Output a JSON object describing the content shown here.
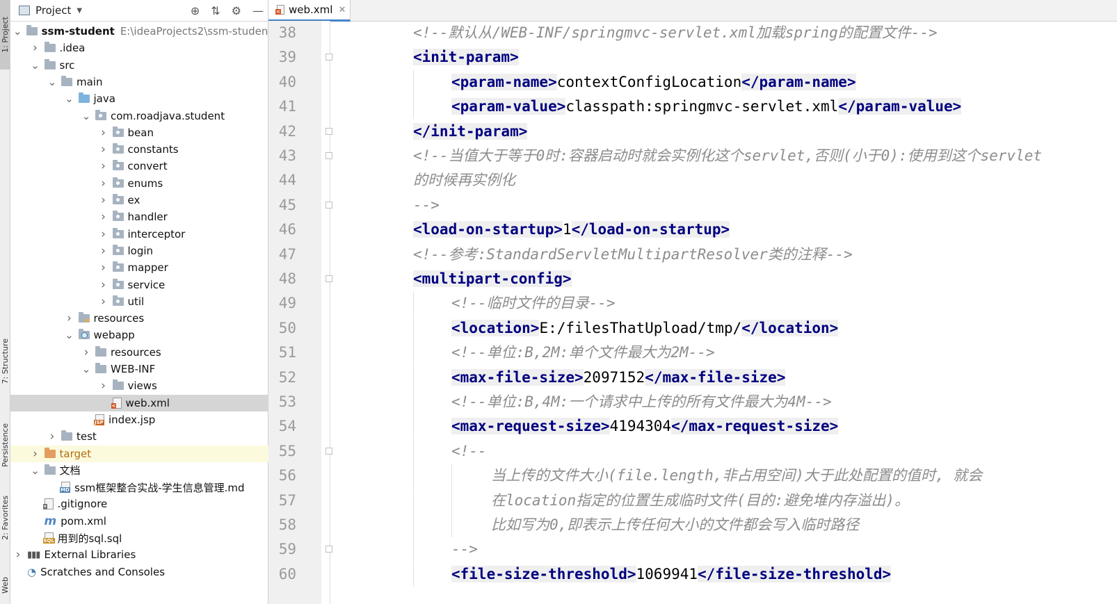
{
  "left_strip": {
    "tabs": [
      "1: Project",
      "7: Structure",
      "Persistence",
      "2: Favorites",
      "Web"
    ]
  },
  "project_panel": {
    "title": "Project",
    "tree": [
      {
        "label": "ssm-student",
        "path": "E:\\ideaProjects2\\ssm-student",
        "icon": "module-folder-icon",
        "depth": 0,
        "arrow": "down",
        "bold": true
      },
      {
        "label": ".idea",
        "icon": "folder-icon",
        "depth": 1,
        "arrow": "right"
      },
      {
        "label": "src",
        "icon": "folder-icon",
        "depth": 1,
        "arrow": "down"
      },
      {
        "label": "main",
        "icon": "folder-icon",
        "depth": 2,
        "arrow": "down"
      },
      {
        "label": "java",
        "icon": "source-folder-icon",
        "depth": 3,
        "arrow": "down"
      },
      {
        "label": "com.roadjava.student",
        "icon": "package-icon",
        "depth": 4,
        "arrow": "down"
      },
      {
        "label": "bean",
        "icon": "package-icon",
        "depth": 5,
        "arrow": "right"
      },
      {
        "label": "constants",
        "icon": "package-icon",
        "depth": 5,
        "arrow": "right"
      },
      {
        "label": "convert",
        "icon": "package-icon",
        "depth": 5,
        "arrow": "right"
      },
      {
        "label": "enums",
        "icon": "package-icon",
        "depth": 5,
        "arrow": "right"
      },
      {
        "label": "ex",
        "icon": "package-icon",
        "depth": 5,
        "arrow": "right"
      },
      {
        "label": "handler",
        "icon": "package-icon",
        "depth": 5,
        "arrow": "right"
      },
      {
        "label": "interceptor",
        "icon": "package-icon",
        "depth": 5,
        "arrow": "right"
      },
      {
        "label": "login",
        "icon": "package-icon",
        "depth": 5,
        "arrow": "right"
      },
      {
        "label": "mapper",
        "icon": "package-icon",
        "depth": 5,
        "arrow": "right"
      },
      {
        "label": "service",
        "icon": "package-icon",
        "depth": 5,
        "arrow": "right"
      },
      {
        "label": "util",
        "icon": "package-icon",
        "depth": 5,
        "arrow": "right"
      },
      {
        "label": "resources",
        "icon": "resources-folder-icon",
        "depth": 3,
        "arrow": "right"
      },
      {
        "label": "webapp",
        "icon": "web-folder-icon",
        "depth": 3,
        "arrow": "down"
      },
      {
        "label": "resources",
        "icon": "folder-icon",
        "depth": 4,
        "arrow": "right"
      },
      {
        "label": "WEB-INF",
        "icon": "folder-icon",
        "depth": 4,
        "arrow": "down"
      },
      {
        "label": "views",
        "icon": "folder-icon",
        "depth": 5,
        "arrow": "right"
      },
      {
        "label": "web.xml",
        "icon": "xml-file-icon",
        "depth": 5,
        "arrow": "none",
        "selected": true
      },
      {
        "label": "index.jsp",
        "icon": "jsp-file-icon",
        "depth": 4,
        "arrow": "none"
      },
      {
        "label": "test",
        "icon": "folder-icon",
        "depth": 2,
        "arrow": "right"
      },
      {
        "label": "target",
        "icon": "excluded-folder-icon",
        "depth": 1,
        "arrow": "right",
        "highlight": true
      },
      {
        "label": "文档",
        "icon": "folder-icon",
        "depth": 1,
        "arrow": "down"
      },
      {
        "label": "ssm框架整合实战-学生信息管理.md",
        "icon": "markdown-file-icon",
        "depth": 2,
        "arrow": "none"
      },
      {
        "label": ".gitignore",
        "icon": "gitignore-file-icon",
        "depth": 1,
        "arrow": "none"
      },
      {
        "label": "pom.xml",
        "icon": "maven-icon",
        "depth": 1,
        "arrow": "none"
      },
      {
        "label": "用到的sql.sql",
        "icon": "sql-file-icon",
        "depth": 1,
        "arrow": "none"
      },
      {
        "label": "External Libraries",
        "icon": "libraries-icon",
        "depth": 0,
        "arrow": "right"
      },
      {
        "label": "Scratches and Consoles",
        "icon": "scratches-icon",
        "depth": 0,
        "arrow": "none"
      }
    ]
  },
  "editor": {
    "tab_label": "web.xml",
    "lines": [
      {
        "n": "38",
        "indent": 0,
        "parts": [
          {
            "t": "cm",
            "v": "<!--默认从/WEB-INF/springmvc-servlet.xml加载spring的配置文件-->"
          }
        ]
      },
      {
        "n": "39",
        "indent": 0,
        "parts": [
          {
            "t": "tg",
            "v": "<init-param>"
          }
        ]
      },
      {
        "n": "40",
        "indent": 1,
        "parts": [
          {
            "t": "tg",
            "v": "<param-name>"
          },
          {
            "t": "tx",
            "v": "contextConfigLocation"
          },
          {
            "t": "tg",
            "v": "</param-name>"
          }
        ]
      },
      {
        "n": "41",
        "indent": 1,
        "parts": [
          {
            "t": "tg",
            "v": "<param-value>"
          },
          {
            "t": "tx",
            "v": "classpath:springmvc-servlet.xml"
          },
          {
            "t": "tg",
            "v": "</param-value>"
          }
        ]
      },
      {
        "n": "42",
        "indent": 0,
        "parts": [
          {
            "t": "tg",
            "v": "</init-param>"
          }
        ]
      },
      {
        "n": "43",
        "indent": 0,
        "parts": [
          {
            "t": "cm",
            "v": "<!--当值大于等于0时:容器启动时就会实例化这个servlet,否则(小于0):使用到这个servlet"
          }
        ]
      },
      {
        "n": "44",
        "indent": 0,
        "parts": [
          {
            "t": "cm",
            "v": "的时候再实例化"
          }
        ]
      },
      {
        "n": "45",
        "indent": 0,
        "parts": [
          {
            "t": "cm",
            "v": "-->"
          }
        ]
      },
      {
        "n": "46",
        "indent": 0,
        "parts": [
          {
            "t": "tg",
            "v": "<load-on-startup>"
          },
          {
            "t": "tx",
            "v": "1"
          },
          {
            "t": "tg",
            "v": "</load-on-startup>"
          }
        ]
      },
      {
        "n": "47",
        "indent": 0,
        "parts": [
          {
            "t": "cm",
            "v": "<!--参考:StandardServletMultipartResolver类的注释-->"
          }
        ]
      },
      {
        "n": "48",
        "indent": 0,
        "parts": [
          {
            "t": "tg",
            "v": "<multipart-config>"
          }
        ]
      },
      {
        "n": "49",
        "indent": 1,
        "parts": [
          {
            "t": "cm",
            "v": "<!--临时文件的目录-->"
          }
        ]
      },
      {
        "n": "50",
        "indent": 1,
        "parts": [
          {
            "t": "tg",
            "v": "<location>"
          },
          {
            "t": "tx",
            "v": "E:/filesThatUpload/tmp/"
          },
          {
            "t": "tg",
            "v": "</location>"
          }
        ]
      },
      {
        "n": "51",
        "indent": 1,
        "parts": [
          {
            "t": "cm",
            "v": "<!--单位:B,2M:单个文件最大为2M-->"
          }
        ]
      },
      {
        "n": "52",
        "indent": 1,
        "parts": [
          {
            "t": "tg",
            "v": "<max-file-size>"
          },
          {
            "t": "tx",
            "v": "2097152"
          },
          {
            "t": "tg",
            "v": "</max-file-size>"
          }
        ]
      },
      {
        "n": "53",
        "indent": 1,
        "parts": [
          {
            "t": "cm",
            "v": "<!--单位:B,4M:一个请求中上传的所有文件最大为4M-->"
          }
        ]
      },
      {
        "n": "54",
        "indent": 1,
        "parts": [
          {
            "t": "tg",
            "v": "<max-request-size>"
          },
          {
            "t": "tx",
            "v": "4194304"
          },
          {
            "t": "tg",
            "v": "</max-request-size>"
          }
        ]
      },
      {
        "n": "55",
        "indent": 1,
        "parts": [
          {
            "t": "cm",
            "v": "<!--"
          }
        ]
      },
      {
        "n": "56",
        "indent": 2,
        "parts": [
          {
            "t": "cm",
            "v": "当上传的文件大小(file.length,非占用空间)大于此处配置的值时, 就会"
          }
        ]
      },
      {
        "n": "57",
        "indent": 2,
        "parts": [
          {
            "t": "cm",
            "v": "在location指定的位置生成临时文件(目的:避免堆内存溢出)。"
          }
        ]
      },
      {
        "n": "58",
        "indent": 2,
        "parts": [
          {
            "t": "cm",
            "v": "比如写为0,即表示上传任何大小的文件都会写入临时路径"
          }
        ]
      },
      {
        "n": "59",
        "indent": 1,
        "parts": [
          {
            "t": "cm",
            "v": "-->"
          }
        ]
      },
      {
        "n": "60",
        "indent": 1,
        "parts": [
          {
            "t": "tg",
            "v": "<file-size-threshold>"
          },
          {
            "t": "tx",
            "v": "1069941"
          },
          {
            "t": "tg",
            "v": "</file-size-threshold>"
          }
        ]
      }
    ]
  }
}
